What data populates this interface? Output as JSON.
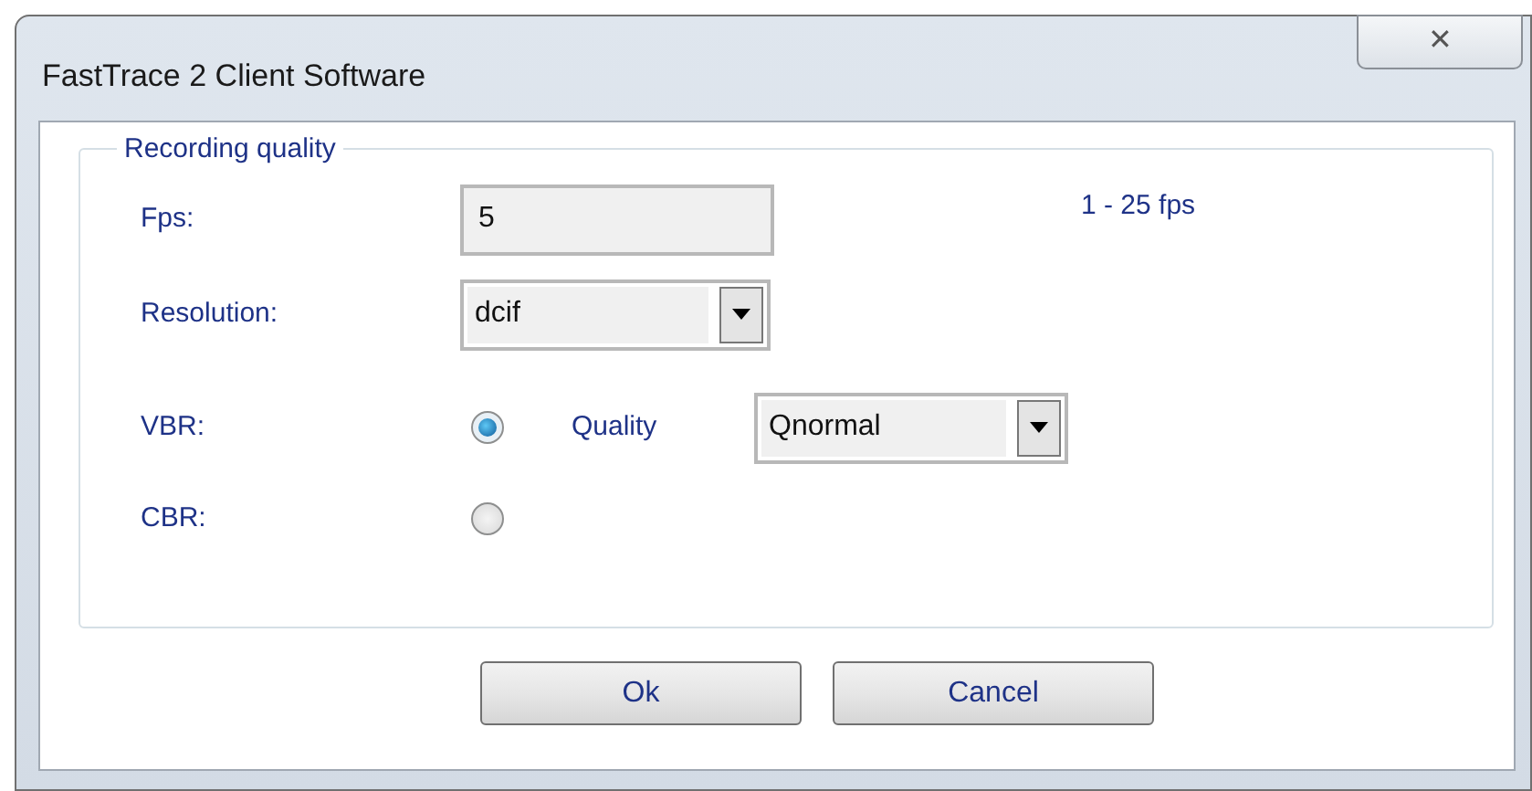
{
  "window": {
    "title": "FastTrace 2 Client Software",
    "close": "✕"
  },
  "group": {
    "title": "Recording quality"
  },
  "fps": {
    "label": "Fps:",
    "value": "5",
    "hint": "1 - 25 fps"
  },
  "resolution": {
    "label": "Resolution:",
    "value": "dcif"
  },
  "modes": [
    {
      "label": "VBR:",
      "selected": true,
      "quality": {
        "label": "Quality",
        "value": "Qnormal"
      }
    },
    {
      "label": "CBR:",
      "selected": false
    }
  ],
  "buttons": [
    "Ok",
    "Cancel"
  ]
}
